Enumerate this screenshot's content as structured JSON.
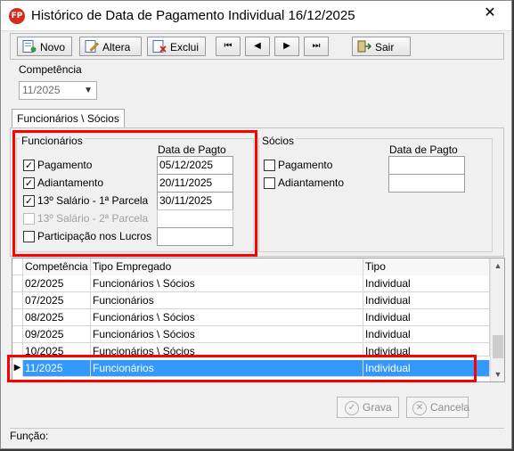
{
  "window": {
    "app_icon_text": "FP",
    "title": "Histórico de Data de Pagamento Individual  16/12/2025",
    "close_glyph": "✕"
  },
  "toolbar": {
    "novo": "Novo",
    "altera": "Altera",
    "exclui": "Exclui",
    "first": "⏮",
    "prev": "◀",
    "next": "▶",
    "last": "⏭",
    "sair": "Sair"
  },
  "competencia": {
    "label": "Competência",
    "value": "11/2025"
  },
  "tab": {
    "label": "Funcionários \\ Sócios"
  },
  "funcionarios": {
    "group_label": "Funcionários",
    "date_header": "Data de Pagto",
    "items": [
      {
        "label": "Pagamento",
        "checked": true,
        "enabled": true,
        "date": "05/12/2025"
      },
      {
        "label": "Adiantamento",
        "checked": true,
        "enabled": true,
        "date": "20/11/2025"
      },
      {
        "label": "13º Salário - 1ª Parcela",
        "checked": true,
        "enabled": true,
        "date": "30/11/2025"
      },
      {
        "label": "13º Salário - 2ª Parcela",
        "checked": false,
        "enabled": false,
        "date": ""
      },
      {
        "label": "Participação nos Lucros",
        "checked": false,
        "enabled": true,
        "date": ""
      }
    ]
  },
  "socios": {
    "group_label": "Sócios",
    "date_header": "Data de Pagto",
    "items": [
      {
        "label": "Pagamento",
        "checked": false,
        "date": ""
      },
      {
        "label": "Adiantamento",
        "checked": false,
        "date": ""
      }
    ]
  },
  "grid": {
    "columns": [
      "Competência",
      "Tipo Empregado",
      "Tipo"
    ],
    "rows": [
      {
        "competencia": "02/2025",
        "tipo_empregado": "Funcionários \\ Sócios",
        "tipo": "Individual"
      },
      {
        "competencia": "07/2025",
        "tipo_empregado": "Funcionários",
        "tipo": "Individual"
      },
      {
        "competencia": "08/2025",
        "tipo_empregado": "Funcionários \\ Sócios",
        "tipo": "Individual"
      },
      {
        "competencia": "09/2025",
        "tipo_empregado": "Funcionários \\ Sócios",
        "tipo": "Individual"
      },
      {
        "competencia": "10/2025",
        "tipo_empregado": "Funcionários \\ Sócios",
        "tipo": "Individual"
      },
      {
        "competencia": "11/2025",
        "tipo_empregado": "Funcionários",
        "tipo": "Individual",
        "selected": true
      }
    ]
  },
  "footer": {
    "grava": "Grava",
    "cancela": "Cancela",
    "funcao_label": "Função:"
  },
  "colors": {
    "highlight": "#ff0000",
    "selected_row": "#3399ff"
  }
}
